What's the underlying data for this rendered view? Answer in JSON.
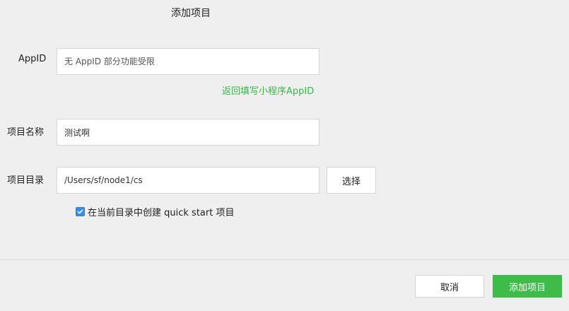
{
  "dialog": {
    "title": "添加项目"
  },
  "appid": {
    "label": "AppID",
    "placeholder": "无 AppID 部分功能受限",
    "value": "",
    "return_link": "返回填写小程序AppID"
  },
  "project_name": {
    "label": "项目名称",
    "value": "测试啊"
  },
  "project_dir": {
    "label": "项目目录",
    "value": "/Users/sf/node1/cs",
    "choose_label": "选择"
  },
  "quickstart": {
    "checked": true,
    "label": "在当前目录中创建 quick start 项目"
  },
  "footer": {
    "cancel_label": "取消",
    "add_label": "添加项目"
  },
  "colors": {
    "accent_green": "#3fbb4a",
    "link_green": "#3bb54a",
    "checkbox_blue": "#3b8ee6",
    "background": "#efefef"
  }
}
